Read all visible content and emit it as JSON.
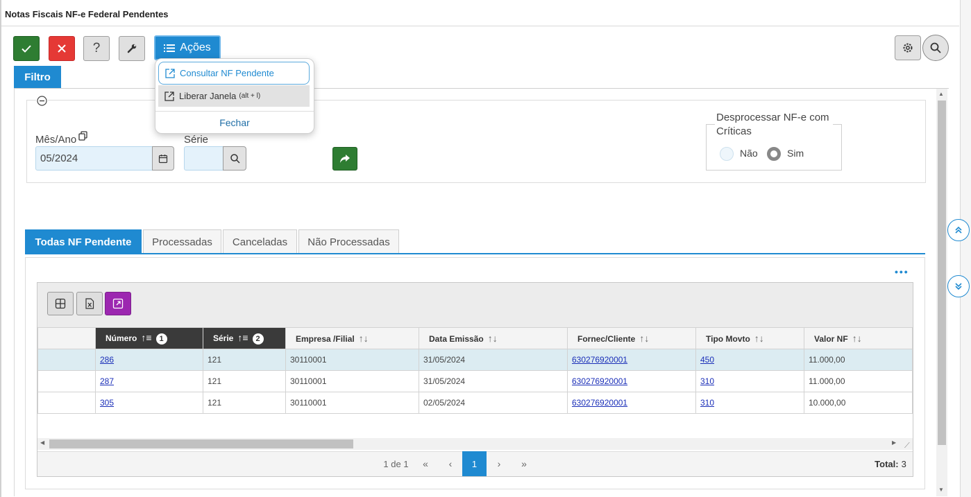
{
  "window": {
    "title": "Notas Fiscais NF-e Federal Pendentes"
  },
  "toolbar": {
    "acoes_label": "Ações",
    "help_label": "?"
  },
  "filter": {
    "tab_label": "Filtro",
    "mes_ano_label": "Mês/Ano",
    "mes_ano_value": "05/2024",
    "serie_label": "Série",
    "serie_value": "",
    "desprocessar_label": "Desprocessar NF-e com Críticas",
    "radio_nao": "Não",
    "radio_sim": "Sim",
    "radio_selected": "Sim"
  },
  "tabs": [
    "Todas NF Pendente",
    "Processadas",
    "Canceladas",
    "Não Processadas"
  ],
  "active_tab": "Todas NF Pendente",
  "grid": {
    "more_label": "•••",
    "columns": [
      {
        "label": "Número",
        "sort": "1"
      },
      {
        "label": "Série",
        "sort": "2"
      },
      {
        "label": "Empresa /Filial",
        "sort": ""
      },
      {
        "label": "Data Emissão",
        "sort": ""
      },
      {
        "label": "Fornec/Cliente",
        "sort": ""
      },
      {
        "label": "Tipo Movto",
        "sort": ""
      },
      {
        "label": "Valor NF",
        "sort": ""
      }
    ],
    "rows": [
      {
        "numero": "286",
        "serie": "121",
        "empresa": "30110001",
        "data": "31/05/2024",
        "fornec": "630276920001",
        "tipo": "450",
        "valor": "11.000,00"
      },
      {
        "numero": "287",
        "serie": "121",
        "empresa": "30110001",
        "data": "31/05/2024",
        "fornec": "630276920001",
        "tipo": "310",
        "valor": "11.000,00"
      },
      {
        "numero": "305",
        "serie": "121",
        "empresa": "30110001",
        "data": "02/05/2024",
        "fornec": "630276920001",
        "tipo": "310",
        "valor": "10.000,00"
      }
    ],
    "selected_row": 0
  },
  "pager": {
    "page_info": "1 de 1",
    "current_page": "1",
    "total_label": "Total:",
    "total_value": "3"
  },
  "dropdown": {
    "item1": "Consultar NF Pendente",
    "item2": "Liberar Janela",
    "item2_shortcut": "(alt + l)",
    "close": "Fechar"
  },
  "colors": {
    "primary": "#1f8ad1",
    "success": "#2e7d32",
    "danger": "#e53935",
    "purple": "#9c27b0"
  }
}
